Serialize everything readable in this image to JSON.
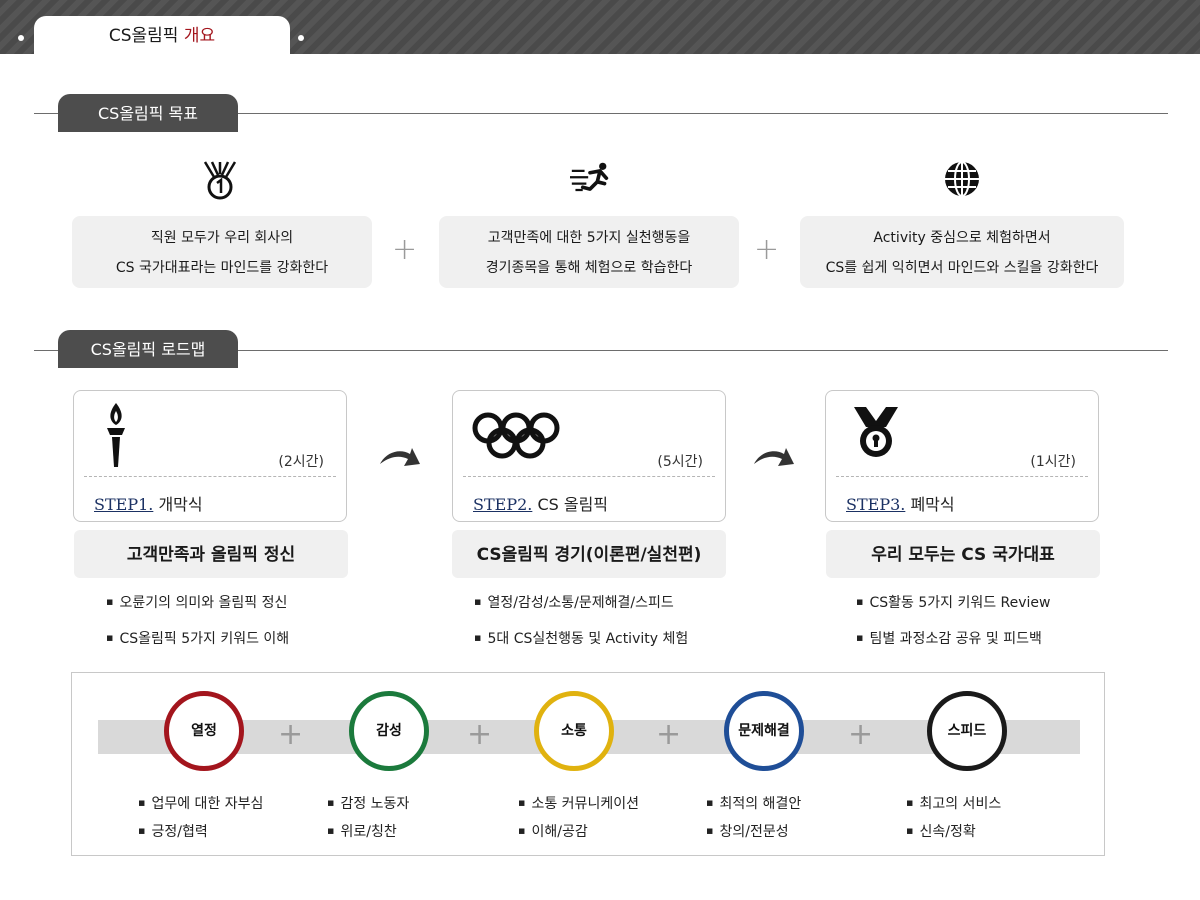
{
  "header": {
    "title_main": "CS올림픽",
    "title_accent": "개요"
  },
  "goals": {
    "section_label": "CS올림픽 목표",
    "items": [
      {
        "icon": "medal-first-icon",
        "line1": "직원 모두가 우리 회사의",
        "line2": "CS 국가대표라는 마인드를 강화한다"
      },
      {
        "icon": "runner-icon",
        "line1": "고객만족에 대한 5가지 실천행동을",
        "line2": "경기종목을 통해 체험으로 학습한다"
      },
      {
        "icon": "globe-icon",
        "line1": "Activity 중심으로 체험하면서",
        "line2": "CS를 쉽게 익히면서 마인드와 스킬을 강화한다"
      }
    ],
    "separator": "+"
  },
  "roadmap": {
    "section_label": "CS올림픽 로드맵",
    "steps": [
      {
        "icon": "torch-icon",
        "time": "(2시간)",
        "step_no": "STEP1.",
        "name": "개막식",
        "subtitle": "고객만족과 올림픽 정신",
        "bullets": [
          "오륜기의 의미와 올림픽 정신",
          "CS올림픽 5가지 키워드 이해"
        ]
      },
      {
        "icon": "olympic-rings-icon",
        "time": "(5시간)",
        "step_no": "STEP2.",
        "name": "CS 올림픽",
        "subtitle": "CS올림픽 경기(이론편/실천편)",
        "bullets": [
          "열정/감성/소통/문제해결/스피드",
          "5대 CS실천행동 및 Activity 체험"
        ]
      },
      {
        "icon": "medal-icon",
        "time": "(1시간)",
        "step_no": "STEP3.",
        "name": "폐막식",
        "subtitle": "우리 모두는 CS 국가대표",
        "bullets": [
          "CS활동 5가지 키워드 Review",
          "팀별 과정소감 공유 및 피드백"
        ]
      }
    ]
  },
  "keywords": {
    "separator": "+",
    "items": [
      {
        "label": "열정",
        "color": "#a3151d",
        "bullets": [
          "업무에 대한 자부심",
          "긍정/협력"
        ]
      },
      {
        "label": "감성",
        "color": "#1b7a3c",
        "bullets": [
          "감정 노동자",
          "위로/칭찬"
        ]
      },
      {
        "label": "소통",
        "color": "#e0b20f",
        "bullets": [
          "소통 커뮤니케이션",
          "이해/공감"
        ]
      },
      {
        "label": "문제해결",
        "color": "#1f4e97",
        "bullets": [
          "최적의 해결안",
          "창의/전문성"
        ]
      },
      {
        "label": "스피드",
        "color": "#1a1a1a",
        "bullets": [
          "최고의 서비스",
          "신속/정확"
        ]
      }
    ]
  }
}
